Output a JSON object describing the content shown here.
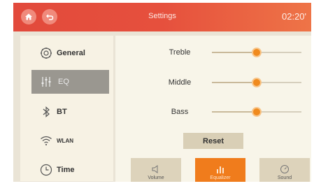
{
  "topbar": {
    "home_icon": "home-icon",
    "back_icon": "back-icon",
    "title": "Settings",
    "clock": "02:20'"
  },
  "sidebar": {
    "items": [
      {
        "label": "General",
        "icon": "gear-icon",
        "active": false
      },
      {
        "label": "EQ",
        "icon": "eq-sliders-icon",
        "active": true
      },
      {
        "label": "BT",
        "icon": "bluetooth-icon",
        "active": false
      },
      {
        "label": "WLAN",
        "icon": "wifi-icon",
        "active": false
      },
      {
        "label": "Time",
        "icon": "clock-icon",
        "active": false
      }
    ]
  },
  "eq": {
    "rows": [
      {
        "label": "Treble",
        "level": 0.5
      },
      {
        "label": "Middle",
        "level": 0.5
      },
      {
        "label": "Bass",
        "level": 0.5
      }
    ],
    "reset_label": "Reset"
  },
  "tabs": [
    {
      "label": "Volume",
      "icon": "speaker-icon",
      "active": false
    },
    {
      "label": "Equalizer",
      "icon": "equalizer-bars-icon",
      "active": true
    },
    {
      "label": "Sound",
      "icon": "sound-dial-icon",
      "active": false
    }
  ],
  "colors": {
    "accent": "#f07c1c",
    "topbar_start": "#e24a3c",
    "topbar_end": "#ee7447",
    "active_sidebar": "#9a9790"
  }
}
